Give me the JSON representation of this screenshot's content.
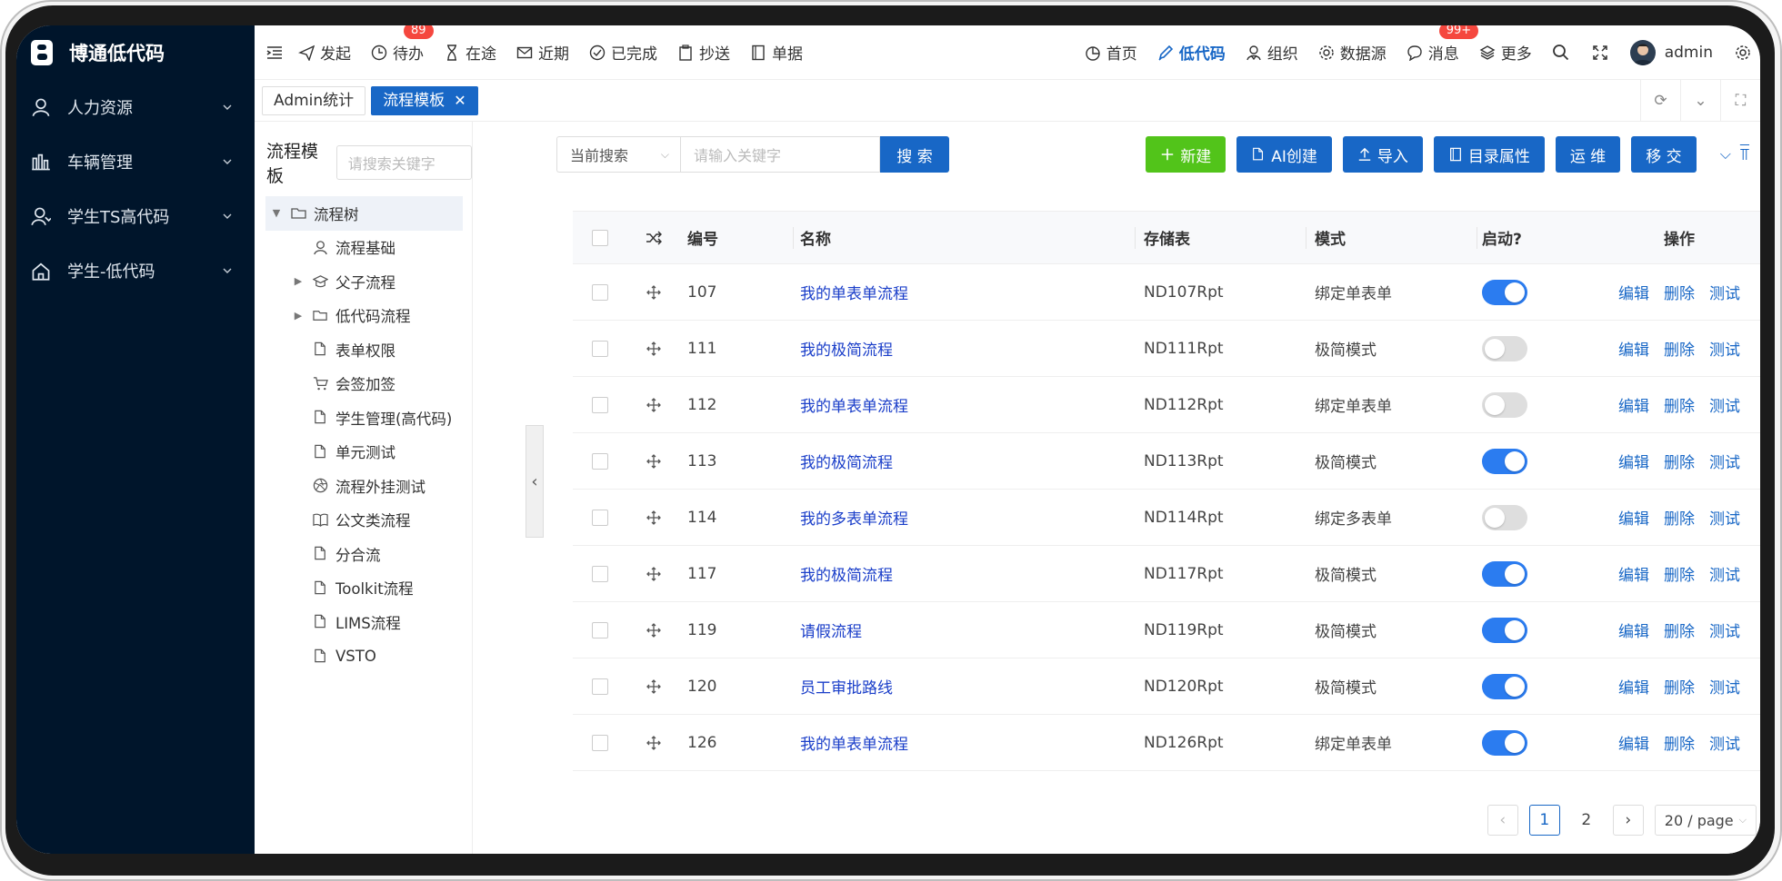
{
  "app": {
    "name": "博通低代码"
  },
  "sidebar": {
    "items": [
      {
        "label": "人力资源",
        "icon": "user-icon"
      },
      {
        "label": "车辆管理",
        "icon": "vehicle-icon"
      },
      {
        "label": "学生TS高代码",
        "icon": "student-icon"
      },
      {
        "label": "学生-低代码",
        "icon": "home-icon"
      }
    ]
  },
  "topbar": {
    "left": [
      {
        "label": "发起",
        "icon": "send-icon"
      },
      {
        "label": "待办",
        "icon": "clock-icon",
        "badge": "89"
      },
      {
        "label": "在途",
        "icon": "hourglass-icon"
      },
      {
        "label": "近期",
        "icon": "mail-icon"
      },
      {
        "label": "已完成",
        "icon": "check-circle-icon"
      },
      {
        "label": "抄送",
        "icon": "clipboard-icon"
      },
      {
        "label": "单据",
        "icon": "doc-icon"
      }
    ],
    "right": [
      {
        "label": "首页",
        "icon": "pie-icon"
      },
      {
        "label": "低代码",
        "icon": "brush-icon",
        "active": true
      },
      {
        "label": "组织",
        "icon": "org-icon"
      },
      {
        "label": "数据源",
        "icon": "gear-icon"
      },
      {
        "label": "消息",
        "icon": "chat-icon",
        "badge": "99+"
      },
      {
        "label": "更多",
        "icon": "layers-icon"
      }
    ],
    "user": "admin",
    "accent": "#1867c6"
  },
  "tabs": [
    {
      "label": "Admin统计",
      "active": false
    },
    {
      "label": "流程模板",
      "active": true
    }
  ],
  "tree": {
    "title": "流程模板",
    "search_placeholder": "请搜索关键字",
    "root": "流程树",
    "nodes": [
      {
        "label": "流程基础",
        "icon": "user-icon",
        "expandable": false
      },
      {
        "label": "父子流程",
        "icon": "cap-icon",
        "expandable": true
      },
      {
        "label": "低代码流程",
        "icon": "folder-icon",
        "expandable": true
      },
      {
        "label": "表单权限",
        "icon": "file-icon",
        "expandable": false
      },
      {
        "label": "会签加签",
        "icon": "cart-icon",
        "expandable": false
      },
      {
        "label": "学生管理(高代码)",
        "icon": "file-icon",
        "expandable": false
      },
      {
        "label": "单元测试",
        "icon": "file-icon",
        "expandable": false
      },
      {
        "label": "流程外挂测试",
        "icon": "aperture-icon",
        "expandable": false
      },
      {
        "label": "公文类流程",
        "icon": "book-icon",
        "expandable": false
      },
      {
        "label": "分合流",
        "icon": "file-icon",
        "expandable": false
      },
      {
        "label": "Toolkit流程",
        "icon": "file-icon",
        "expandable": false
      },
      {
        "label": "LIMS流程",
        "icon": "file-icon",
        "expandable": false
      },
      {
        "label": "VSTO",
        "icon": "file-icon",
        "expandable": false
      }
    ]
  },
  "toolbar": {
    "scope": "当前搜索",
    "keyword_placeholder": "请输入关键字",
    "search": "搜 索",
    "buttons": [
      {
        "label": "新建",
        "color": "#52c41a",
        "icon": "plus-icon"
      },
      {
        "label": "AI创建",
        "color": "#1867c6",
        "icon": "file-icon"
      },
      {
        "label": "导入",
        "color": "#1867c6",
        "icon": "upload-icon"
      },
      {
        "label": "目录属性",
        "color": "#1867c6",
        "icon": "doc-icon"
      },
      {
        "label": "运 维",
        "color": "#1867c6",
        "icon": ""
      },
      {
        "label": "移 交",
        "color": "#1867c6",
        "icon": ""
      }
    ]
  },
  "table": {
    "headers": [
      "编号",
      "名称",
      "存储表",
      "模式",
      "启动?",
      "操作"
    ],
    "ops": [
      "编辑",
      "删除",
      "测试"
    ],
    "rows": [
      {
        "no": "107",
        "name": "我的单表单流程",
        "store": "ND107Rpt",
        "mode": "绑定单表单",
        "on": true
      },
      {
        "no": "111",
        "name": "我的极简流程",
        "store": "ND111Rpt",
        "mode": "极简模式",
        "on": false
      },
      {
        "no": "112",
        "name": "我的单表单流程",
        "store": "ND112Rpt",
        "mode": "绑定单表单",
        "on": false
      },
      {
        "no": "113",
        "name": "我的极简流程",
        "store": "ND113Rpt",
        "mode": "极简模式",
        "on": true
      },
      {
        "no": "114",
        "name": "我的多表单流程",
        "store": "ND114Rpt",
        "mode": "绑定多表单",
        "on": false
      },
      {
        "no": "117",
        "name": "我的极简流程",
        "store": "ND117Rpt",
        "mode": "极简模式",
        "on": true
      },
      {
        "no": "119",
        "name": "请假流程",
        "store": "ND119Rpt",
        "mode": "极简模式",
        "on": true
      },
      {
        "no": "120",
        "name": "员工审批路线",
        "store": "ND120Rpt",
        "mode": "极简模式",
        "on": true
      },
      {
        "no": "126",
        "name": "我的单表单流程",
        "store": "ND126Rpt",
        "mode": "绑定单表单",
        "on": true
      }
    ]
  },
  "pager": {
    "pages": [
      "1",
      "2"
    ],
    "current": "1",
    "page_size": "20 / page"
  }
}
